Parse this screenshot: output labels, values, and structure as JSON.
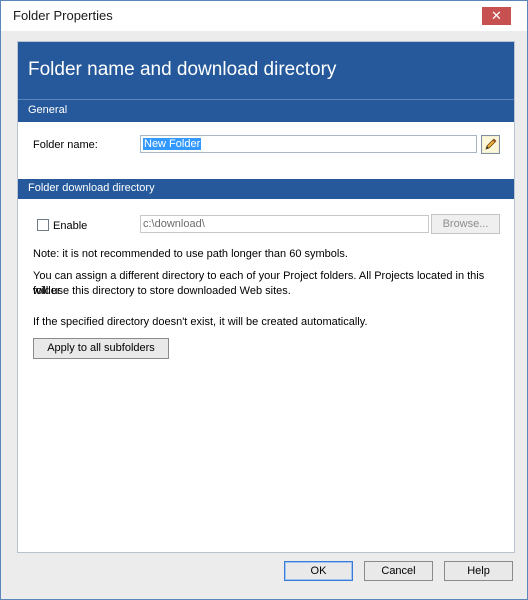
{
  "window": {
    "title": "Folder Properties",
    "close_glyph": "✕"
  },
  "header": {
    "title": "Folder name and download directory"
  },
  "general": {
    "section_title": "General",
    "folder_name_label": "Folder name:",
    "folder_name_value": "New Folder"
  },
  "download": {
    "section_title": "Folder download directory",
    "enable_label": "Enable",
    "enable_checked": false,
    "directory_value": "c:\\download\\",
    "browse_label": "Browse...",
    "note1": "Note: it is not recommended to use path longer than 60 symbols.",
    "note2_line1": "You can assign a different directory to each of your Project folders.  All Projects located in this folder",
    "note2_line2": "will use this directory to store downloaded Web sites.",
    "note3": "If the specified directory doesn't exist, it will be created automatically.",
    "apply_label": "Apply to all subfolders"
  },
  "footer": {
    "ok_label": "OK",
    "cancel_label": "Cancel",
    "help_label": "Help"
  },
  "icons": {
    "edit": "pencil-icon",
    "close": "close-icon"
  },
  "colors": {
    "header_blue": "#25599b",
    "close_red": "#c75050",
    "selection": "#3399ff"
  }
}
